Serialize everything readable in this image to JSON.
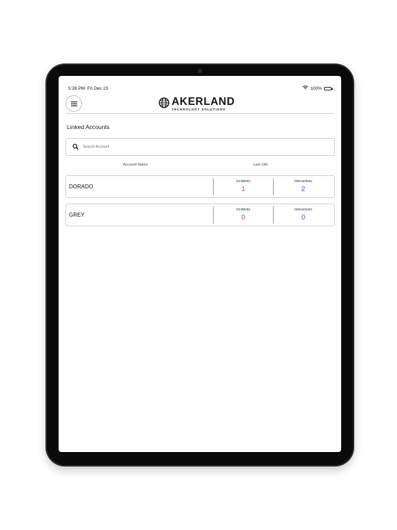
{
  "status_bar": {
    "time": "5:28 PM",
    "date": "Fri Dec 23",
    "battery": "100%",
    "icons": [
      "wifi-icon",
      "battery-icon"
    ]
  },
  "header": {
    "menu_icon": "hamburger-menu-icon",
    "logo_icon": "globe-icon",
    "logo_main": "AKERLAND",
    "logo_sub": "TECHNOLOGY SOLUTIONS"
  },
  "page": {
    "title": "Linked Accounts"
  },
  "search": {
    "icon": "search-icon",
    "placeholder": "Search Account",
    "value": ""
  },
  "columns": {
    "account_name": "Account Name",
    "last_24h": "Last 24h"
  },
  "accounts": [
    {
      "name": "DORADO",
      "incidents_label": "Incidents",
      "incidents": "1",
      "interactions_label": "Interactions",
      "interactions": "2"
    },
    {
      "name": "GREY",
      "incidents_label": "Incidents",
      "incidents": "0",
      "interactions_label": "Interactions",
      "interactions": "0"
    }
  ],
  "colors": {
    "incident_value": "#c44a4a",
    "interaction_value": "#4a5aa0",
    "divider": "#9a9cb8",
    "card_border": "#cfcfcf"
  }
}
